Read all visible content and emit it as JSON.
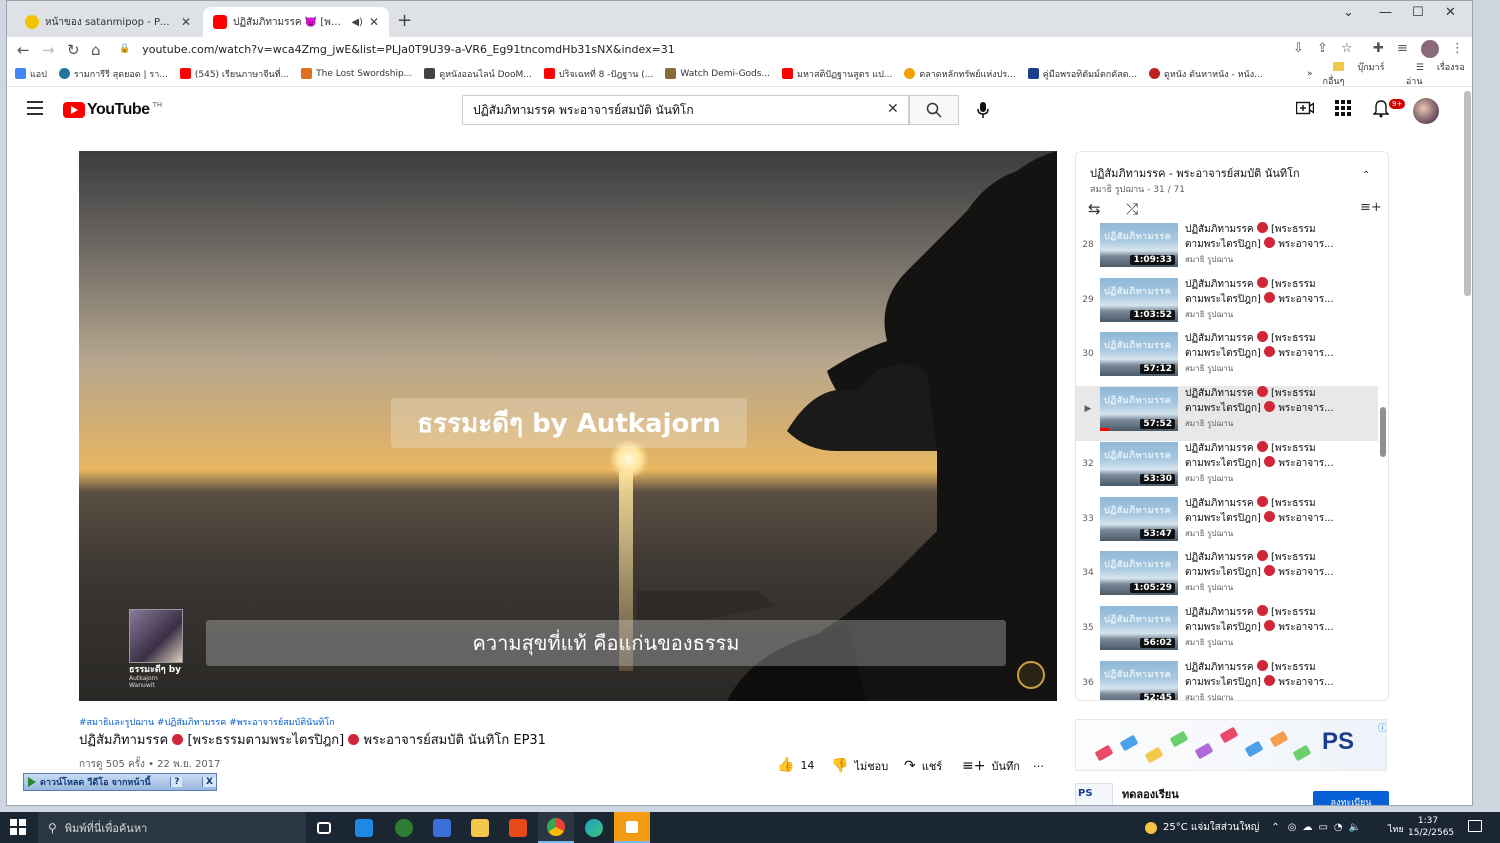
{
  "browser": {
    "tabs": [
      {
        "title": "หน้าของ satanmipop - Pantip",
        "icon_color": "#f5c400"
      },
      {
        "title": "ปฏิสัมภิทามรรค 👿 [พระธรรมต",
        "icon_color": "#ff0000"
      }
    ],
    "url": "youtube.com/watch?v=wca4Zmg_jwE&list=PLJa0T9U39-a-VR6_Eg91tncomdHb31sNX&index=31",
    "bookmarks": [
      {
        "label": "แอป",
        "color": "#4285f4"
      },
      {
        "label": "รามการีรี สุดยอด | รา...",
        "color": "#21759b"
      },
      {
        "label": "(545) เรียนภาษาจีนที่...",
        "color": "#ff0000"
      },
      {
        "label": "The Lost Swordship...",
        "color": "#e07020"
      },
      {
        "label": "ดูหนังออนไลน์ DooM...",
        "color": "#444444"
      },
      {
        "label": "ปริจเฉทที่ 8 -ปัฎฐาน (...",
        "color": "#ff0000"
      },
      {
        "label": "Watch Demi-Gods...",
        "color": "#8a6a3a"
      },
      {
        "label": "มหาสติปัฏฐานสูตร แป...",
        "color": "#ff0000"
      },
      {
        "label": "ตลาดหลักทรัพย์แห่งปร...",
        "color": "#f0a000"
      },
      {
        "label": "คู่มือพรอทิตัมม์ตกตัสต...",
        "color": "#1a3e8c"
      },
      {
        "label": "ดูหนัง ดันหาหนัง - หนัง...",
        "color": "#c02020"
      }
    ],
    "bookmarks_more": "»",
    "bookmarks_folder": "บุ๊กมาร์กอื่นๆ",
    "reading_list": "เรื่องรออ่าน"
  },
  "youtube": {
    "logo": "YouTube",
    "logo_region": "TH",
    "search_query": "ปฏิสัมภิทามรรค พระอาจารย์สมบัติ นันทิโก",
    "notification_count": "9+",
    "video": {
      "overlay_title": "ธรรมะดีๆ by Autkajorn",
      "overlay_subtitle": "ความสุขที่แท้ คือแก่นของธรรม",
      "channel_mark_line1": "ธรรมะดีๆ by",
      "channel_mark_line2": "Autkajorn Wanuwit"
    },
    "hashtags": "#สมาธิและรูปฌาน #ปฏิสัมภิทามรรค #พระอาจารย์สมบัตินันทิโก",
    "title_part1": "ปฏิสัมภิทามรรค",
    "title_part2": "[พระธรรมตามพระไตรปิฎก]",
    "title_part3": "พระอาจารย์สมบัติ นันทิโก EP31",
    "meta": "การดู 505 ครั้ง • 22 พ.ย. 2017",
    "actions": {
      "like_count": "14",
      "dislike": "ไม่ชอบ",
      "share": "แชร์",
      "save": "บันทึก",
      "more": "…"
    },
    "download_bar": {
      "label": "ดาวน์โหลด วีดีโอ จากหน้านี้",
      "help": "?",
      "close": "X"
    },
    "playlist": {
      "title": "ปฏิสัมภิทามรรค - พระอาจารย์สมบัติ นันทิโก",
      "channel": "สมาธิ รูปฌาน",
      "position": "31 / 71",
      "items": [
        {
          "index": "28",
          "line1": "ปฏิสัมภิทามรรค",
          "line1b": "[พระธรรม",
          "line2a": "ตามพระไตรปิฎก]",
          "line2b": "พระอาจาร...",
          "channel": "สมาธิ รูปฌาน",
          "duration": "1:09:33",
          "thumb_text": "ปฏิสัมภิทามรรค"
        },
        {
          "index": "29",
          "line1": "ปฏิสัมภิทามรรค",
          "line1b": "[พระธรรม",
          "line2a": "ตามพระไตรปิฎก]",
          "line2b": "พระอาจาร...",
          "channel": "สมาธิ รูปฌาน",
          "duration": "1:03:52",
          "thumb_text": "ปฏิสัมภิทามรรค"
        },
        {
          "index": "30",
          "line1": "ปฏิสัมภิทามรรค",
          "line1b": "[พระธรรม",
          "line2a": "ตามพระไตรปิฎก]",
          "line2b": "พระอาจาร...",
          "channel": "สมาธิ รูปฌาน",
          "duration": "57:12",
          "thumb_text": "ปฏิสัมภิทามรรค"
        },
        {
          "index": "▶",
          "line1": "ปฏิสัมภิทามรรค",
          "line1b": "[พระธรรม",
          "line2a": "ตามพระไตรปิฎก]",
          "line2b": "พระอาจาร...",
          "channel": "สมาธิ รูปฌาน",
          "duration": "57:52",
          "thumb_text": "ปฏิสัมภิทามรรค",
          "current": true,
          "progress": 0.12
        },
        {
          "index": "32",
          "line1": "ปฏิสัมภิทามรรค",
          "line1b": "[พระธรรม",
          "line2a": "ตามพระไตรปิฎก]",
          "line2b": "พระอาจาร...",
          "channel": "สมาธิ รูปฌาน",
          "duration": "53:30",
          "thumb_text": "ปฏิสัมภิทามรรค"
        },
        {
          "index": "33",
          "line1": "ปฏิสัมภิทามรรค",
          "line1b": "[พระธรรม",
          "line2a": "ตามพระไตรปิฎก]",
          "line2b": "พระอาจาร...",
          "channel": "สมาธิ รูปฌาน",
          "duration": "53:47",
          "thumb_text": "ปฏิสัมภิทามรรค"
        },
        {
          "index": "34",
          "line1": "ปฏิสัมภิทามรรค",
          "line1b": "[พระธรรม",
          "line2a": "ตามพระไตรปิฎก]",
          "line2b": "พระอาจาร...",
          "channel": "สมาธิ รูปฌาน",
          "duration": "1:05:29",
          "thumb_text": "ปฏิสัมภิทามรรค"
        },
        {
          "index": "35",
          "line1": "ปฏิสัมภิทามรรค",
          "line1b": "[พระธรรม",
          "line2a": "ตามพระไตรปิฎก]",
          "line2b": "พระอาจาร...",
          "channel": "สมาธิ รูปฌาน",
          "duration": "56:02",
          "thumb_text": "ปฏิสัมภิทามรรค"
        },
        {
          "index": "36",
          "line1": "ปฏิสัมภิทามรรค",
          "line1b": "[พระธรรม",
          "line2a": "ตามพระไตรปิฎก]",
          "line2b": "พระอาจาร...",
          "channel": "สมาธิ รูปฌาน",
          "duration": "52:45",
          "thumb_text": "ปฏิสัมภิทามรรค"
        }
      ]
    },
    "ads": {
      "banner_brand": "PS",
      "sponsor_title": "ทดลองเรียน",
      "sponsor_logo": "PS",
      "sponsor_button": "ลงทะเบียน"
    }
  },
  "taskbar": {
    "search_placeholder": "พิมพ์ที่นี่เพื่อค้นหา",
    "weather": "25°C แจ่มใสส่วนใหญ่",
    "language": "ไทย",
    "time": "1:37",
    "date": "15/2/2565",
    "apps": [
      {
        "name": "task-view",
        "color": "#ffffff"
      },
      {
        "name": "mail",
        "color": "#1e88e5"
      },
      {
        "name": "xbox",
        "color": "#2e7d32"
      },
      {
        "name": "app-blue",
        "color": "#3a6fd8"
      },
      {
        "name": "file-explorer",
        "color": "#f2c94c"
      },
      {
        "name": "office",
        "color": "#e64a19"
      },
      {
        "name": "chrome",
        "color": "#34a853"
      },
      {
        "name": "edge",
        "color": "#1da1c8"
      },
      {
        "name": "app-orange",
        "color": "#f39c12"
      }
    ]
  },
  "colors": {
    "accent": "#065fd4",
    "youtube_red": "#ff0000",
    "taskbar": "#1b2633"
  }
}
